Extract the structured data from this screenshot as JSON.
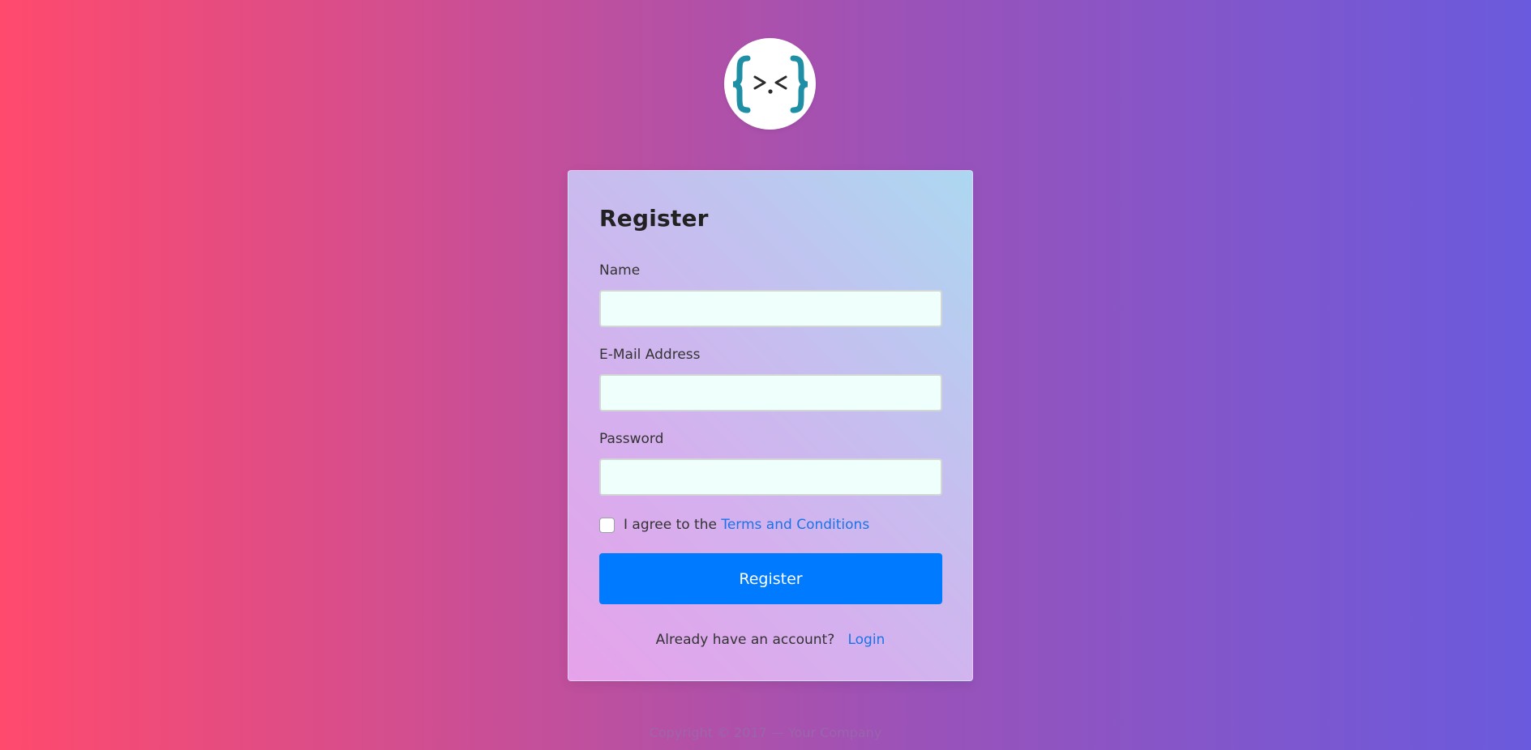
{
  "brand": {
    "icon": "code-brackets-logo-icon",
    "colors": {
      "braces": "#1f8fa6",
      "face": "#2b2b2b",
      "background": "#ffffff"
    }
  },
  "form": {
    "title": "Register",
    "fields": {
      "name": {
        "label": "Name",
        "value": "",
        "placeholder": ""
      },
      "email": {
        "label": "E-Mail Address",
        "value": "",
        "placeholder": ""
      },
      "password": {
        "label": "Password",
        "value": "",
        "placeholder": ""
      }
    },
    "agree": {
      "prefix": "I agree to the",
      "link_text": "Terms and Conditions",
      "checked": false
    },
    "submit_label": "Register",
    "account": {
      "prompt": "Already have an account?",
      "login_link": "Login"
    }
  },
  "footer": {
    "copyright": "Copyright © 2017 — Your Company"
  },
  "colors": {
    "primary": "#007bff",
    "link": "#1a73e8",
    "input_bg": "#effffb"
  }
}
